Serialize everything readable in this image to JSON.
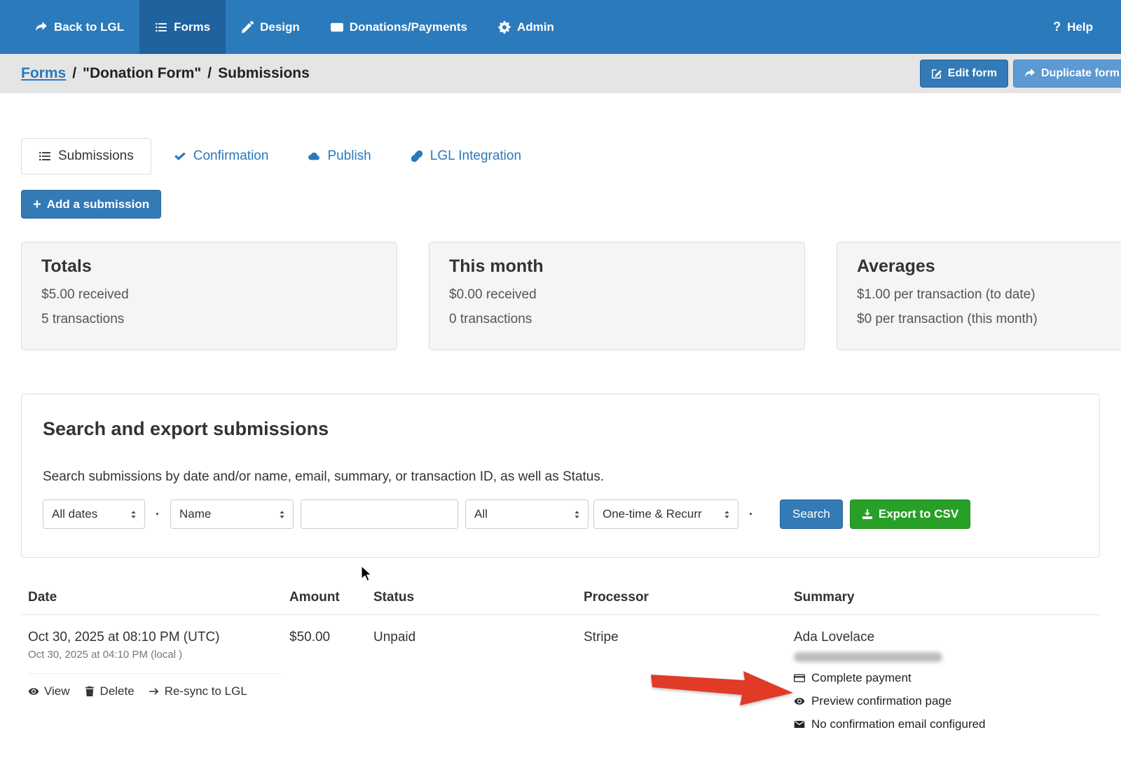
{
  "nav": {
    "back_label": "Back to LGL",
    "forms_label": "Forms",
    "design_label": "Design",
    "donations_label": "Donations/Payments",
    "admin_label": "Admin",
    "help_q": "?",
    "help_label": "Help"
  },
  "breadcrumb": {
    "forms_link": "Forms",
    "sep1": "/",
    "form_name": "\"Donation Form\"",
    "sep2": "/",
    "current": "Submissions"
  },
  "header_actions": {
    "edit_form": "Edit form",
    "duplicate_form": "Duplicate form"
  },
  "tabs": {
    "submissions": "Submissions",
    "confirmation": "Confirmation",
    "publish": "Publish",
    "lgl_integration": "LGL Integration"
  },
  "add_submission_plus": "+",
  "add_submission_label": "Add a submission",
  "stats": {
    "cards": [
      {
        "title": "Totals",
        "line1": "$5.00 received",
        "line2": "5 transactions"
      },
      {
        "title": "This month",
        "line1": "$0.00 received",
        "line2": "0 transactions"
      },
      {
        "title": "Averages",
        "line1": "$1.00 per transaction (to date)",
        "line2": "$0 per transaction (this month)"
      }
    ]
  },
  "search": {
    "title": "Search and export submissions",
    "description": "Search submissions by date and/or name, email, summary, or transaction ID, as well as Status.",
    "date_filter": "All dates",
    "field_filter": "Name",
    "query_value": "",
    "status_filter": "All",
    "type_filter": "One-time & Recurr",
    "dot": "·",
    "search_button": "Search",
    "export_button": "Export to CSV"
  },
  "table": {
    "headers": {
      "date": "Date",
      "amount": "Amount",
      "status": "Status",
      "processor": "Processor",
      "summary": "Summary"
    },
    "rows": [
      {
        "date_utc": "Oct 30, 2025 at 08:10 PM (UTC)",
        "date_local": "Oct 30, 2025 at 04:10 PM (local )",
        "actions": {
          "view": "View",
          "delete": "Delete",
          "resync": "Re-sync to LGL"
        },
        "amount": "$50.00",
        "status": "Unpaid",
        "processor": "Stripe",
        "summary": {
          "name": "Ada Lovelace",
          "complete_payment": "Complete payment",
          "preview_confirmation": "Preview confirmation page",
          "no_confirmation_email": "No confirmation email configured"
        }
      }
    ]
  },
  "icons": {
    "back": "share-arrow-icon",
    "forms": "list-icon",
    "design": "pencil-icon",
    "donations": "banknote-icon",
    "admin": "gear-icon",
    "help": "question-icon",
    "edit_form": "edit-square-icon",
    "duplicate_form": "share-arrow-icon",
    "confirmation_tab": "check-icon",
    "publish_tab": "cloud-icon",
    "lgl_integration_tab": "link-icon",
    "export": "download-icon",
    "view": "eye-icon",
    "delete": "trash-icon",
    "resync": "arrow-right-icon",
    "complete_payment": "credit-card-icon",
    "preview_confirmation": "eye-icon",
    "no_confirmation_email": "envelope-icon",
    "annotation": "red-arrow",
    "pointer": "mouse-cursor"
  },
  "colors": {
    "nav_blue": "#2b7abc",
    "nav_active_blue": "#1f629e",
    "link_blue": "#2a79bd",
    "button_blue": "#337ab7",
    "duplicate_blue": "#5d99d2",
    "export_green": "#28a028",
    "card_bg": "#f5f5f5",
    "annotation_red": "#e13a27"
  }
}
